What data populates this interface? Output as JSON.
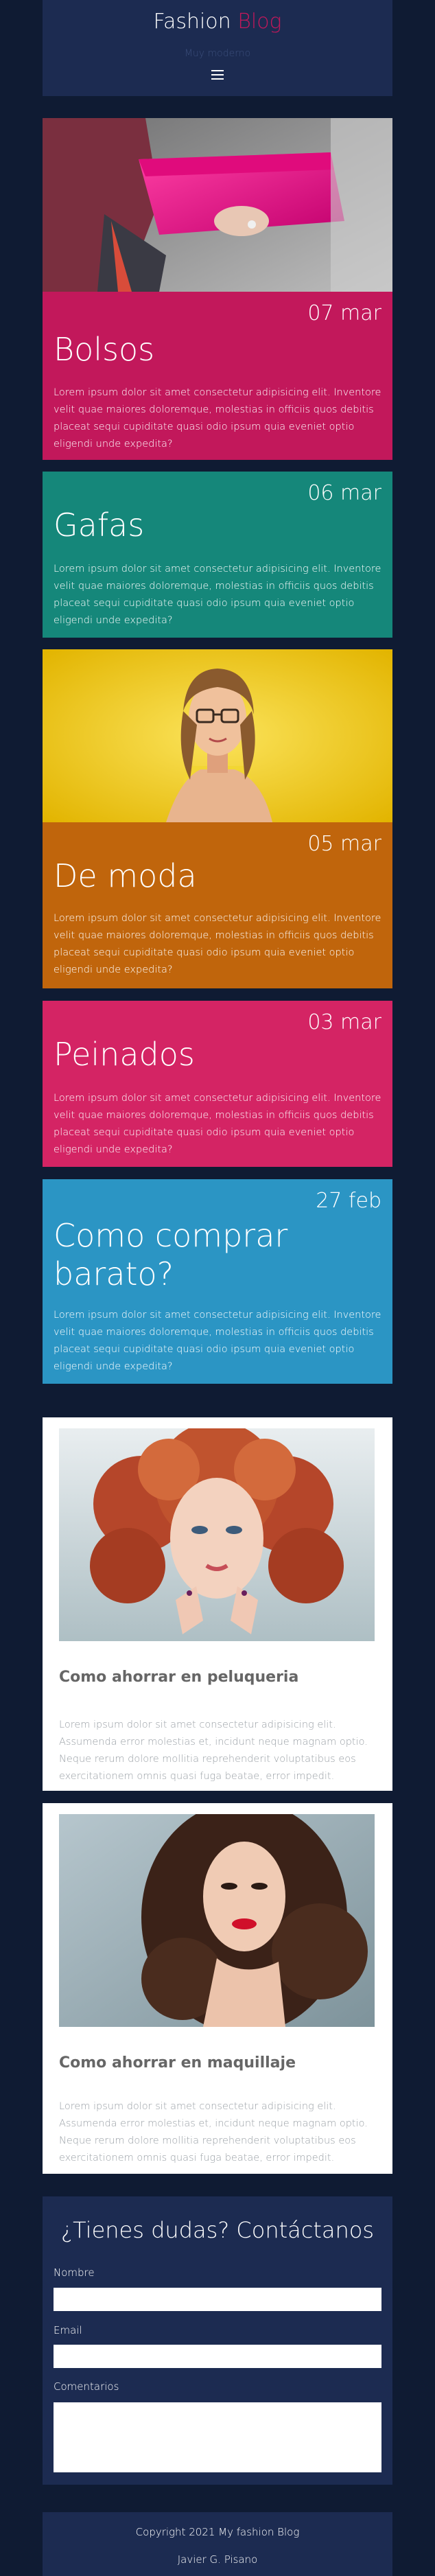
{
  "header": {
    "brand_part1": "Fashion",
    "brand_part2": "Blog",
    "tagline": "Muy moderno",
    "menu_icon": "hamburger-icon"
  },
  "posts": [
    {
      "date": "07 mar",
      "title": "Bolsos",
      "body": "Lorem ipsum dolor sit amet consectetur adipisicing elit. Inventore velit quae maiores doloremque, molestias in officiis quos debitis placeat sequi cupiditate quasi odio ipsum quia eveniet optio eligendi unde expedita?",
      "color": "#c2185b"
    },
    {
      "date": "06 mar",
      "title": "Gafas",
      "body": "Lorem ipsum dolor sit amet consectetur adipisicing elit. Inventore velit quae maiores doloremque, molestias in officiis quos debitis placeat sequi cupiditate quasi odio ipsum quia eveniet optio eligendi unde expedita?",
      "color": "#15877a"
    },
    {
      "date": "05 mar",
      "title": "De moda",
      "body": "Lorem ipsum dolor sit amet consectetur adipisicing elit. Inventore velit quae maiores doloremque, molestias in officiis quos debitis placeat sequi cupiditate quasi odio ipsum quia eveniet optio eligendi unde expedita?",
      "color": "#c0650c"
    },
    {
      "date": "03 mar",
      "title": "Peinados",
      "body": "Lorem ipsum dolor sit amet consectetur adipisicing elit. Inventore velit quae maiores doloremque, molestias in officiis quos debitis placeat sequi cupiditate quasi odio ipsum quia eveniet optio eligendi unde expedita?",
      "color": "#d42464"
    },
    {
      "date": "27 feb",
      "title_line1": "Como comprar",
      "title_line2": "barato?",
      "body": "Lorem ipsum dolor sit amet consectetur adipisicing elit. Inventore velit quae maiores doloremque, molestias in officiis quos debitis placeat sequi cupiditate quasi odio ipsum quia eveniet optio eligendi unde expedita?",
      "color": "#2b95c4"
    }
  ],
  "articles": [
    {
      "title": "Como ahorrar en peluqueria",
      "body": "Lorem ipsum dolor sit amet consectetur adipisicing elit. Assumenda error molestias et, incidunt neque magnam optio. Neque rerum dolore mollitia reprehenderit voluptatibus eos exercitationem omnis quasi fuga beatae, error impedit."
    },
    {
      "title": "Como ahorrar en maquillaje",
      "body": "Lorem ipsum dolor sit amet consectetur adipisicing elit. Assumenda error molestias et, incidunt neque magnam optio. Neque rerum dolore mollitia reprehenderit voluptatibus eos exercitationem omnis quasi fuga beatae, error impedit."
    }
  ],
  "contact": {
    "heading": "¿Tienes dudas? Contáctanos",
    "name_label": "Nombre",
    "email_label": "Email",
    "comments_label": "Comentarios"
  },
  "footer": {
    "copyright": "Copyright 2021 My fashion Blog",
    "author": "Javier G. Pisano"
  },
  "colors": {
    "page_bg": "#0f1b33",
    "header_bg": "#1c2b51",
    "accent": "#c2185b"
  }
}
